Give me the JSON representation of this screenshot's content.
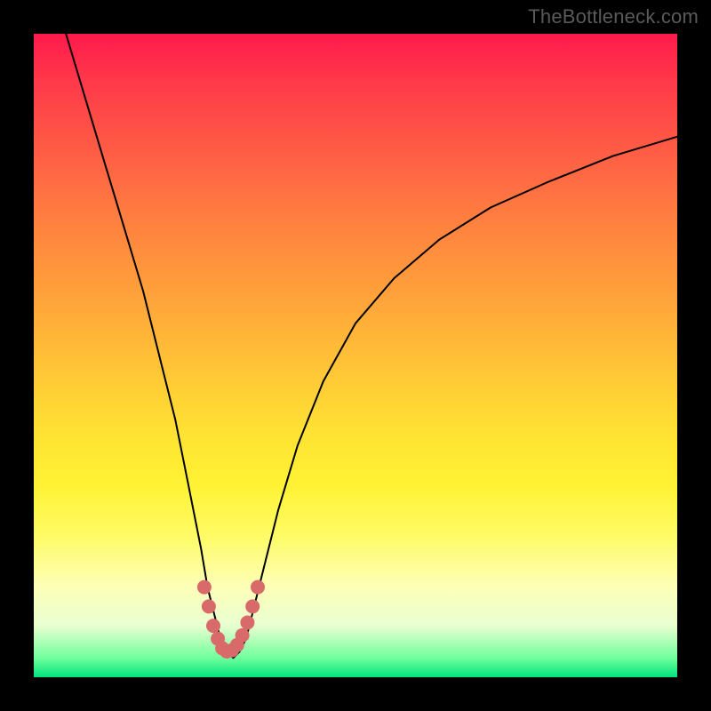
{
  "watermark": "TheBottleneck.com",
  "chart_data": {
    "type": "line",
    "title": "",
    "xlabel": "",
    "ylabel": "",
    "xlim": [
      0,
      100
    ],
    "ylim": [
      0,
      100
    ],
    "series": [
      {
        "name": "main-curve",
        "x": [
          5,
          8,
          11,
          14,
          17,
          20,
          22,
          24,
          26,
          27,
          28,
          29,
          30,
          31,
          32,
          33,
          34,
          36,
          38,
          41,
          45,
          50,
          56,
          63,
          71,
          80,
          90,
          100
        ],
        "y": [
          100,
          90,
          80,
          70,
          60,
          48,
          40,
          30,
          20,
          14,
          10,
          6,
          4,
          3,
          4,
          6,
          10,
          18,
          26,
          36,
          46,
          55,
          62,
          68,
          73,
          77,
          81,
          84
        ]
      },
      {
        "name": "marker-dots",
        "x": [
          26.5,
          27.2,
          27.9,
          28.6,
          29.3,
          30.0,
          30.8,
          31.6,
          32.4,
          33.2,
          34.0,
          34.8
        ],
        "y": [
          14,
          11,
          8,
          6,
          4.5,
          4,
          4.2,
          5,
          6.5,
          8.5,
          11,
          14
        ]
      }
    ],
    "marker_color": "#d96a6a",
    "curve_color": "#000000"
  }
}
